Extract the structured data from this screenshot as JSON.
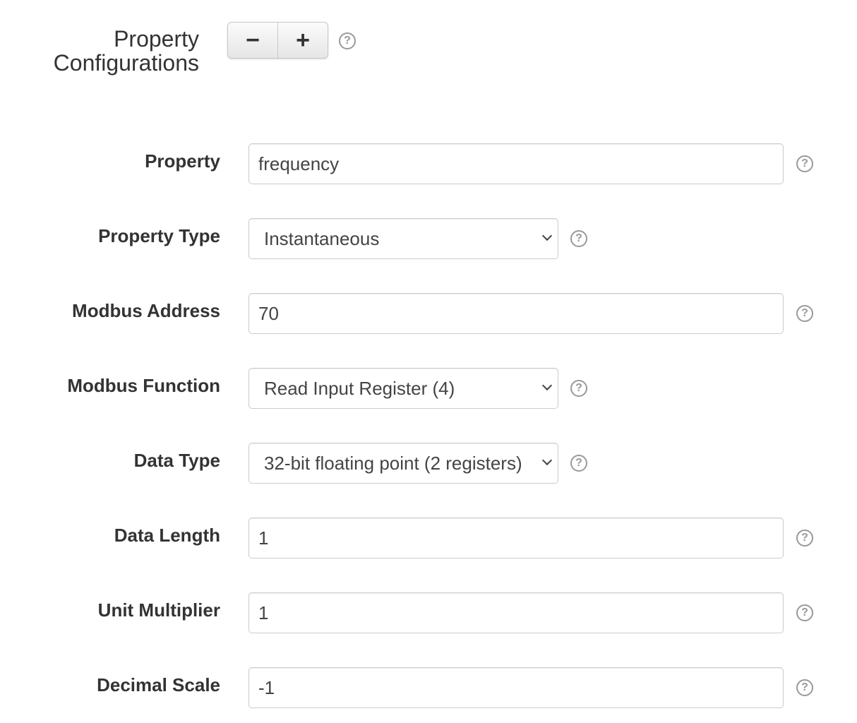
{
  "header": {
    "title_line1": "Property",
    "title_line2": "Configurations",
    "minus_label": "−",
    "plus_label": "+",
    "help": "?"
  },
  "fields": [
    {
      "label": "Property",
      "value": "frequency",
      "type": "text"
    },
    {
      "label": "Property Type",
      "value": "Instantaneous",
      "type": "select"
    },
    {
      "label": "Modbus Address",
      "value": "70",
      "type": "text"
    },
    {
      "label": "Modbus Function",
      "value": "Read Input Register (4)",
      "type": "select"
    },
    {
      "label": "Data Type",
      "value": "32-bit floating point (2 registers)",
      "type": "select"
    },
    {
      "label": "Data Length",
      "value": "1",
      "type": "text"
    },
    {
      "label": "Unit Multiplier",
      "value": "1",
      "type": "text"
    },
    {
      "label": "Decimal Scale",
      "value": "-1",
      "type": "text"
    }
  ],
  "help_icon": "question-circle-icon"
}
